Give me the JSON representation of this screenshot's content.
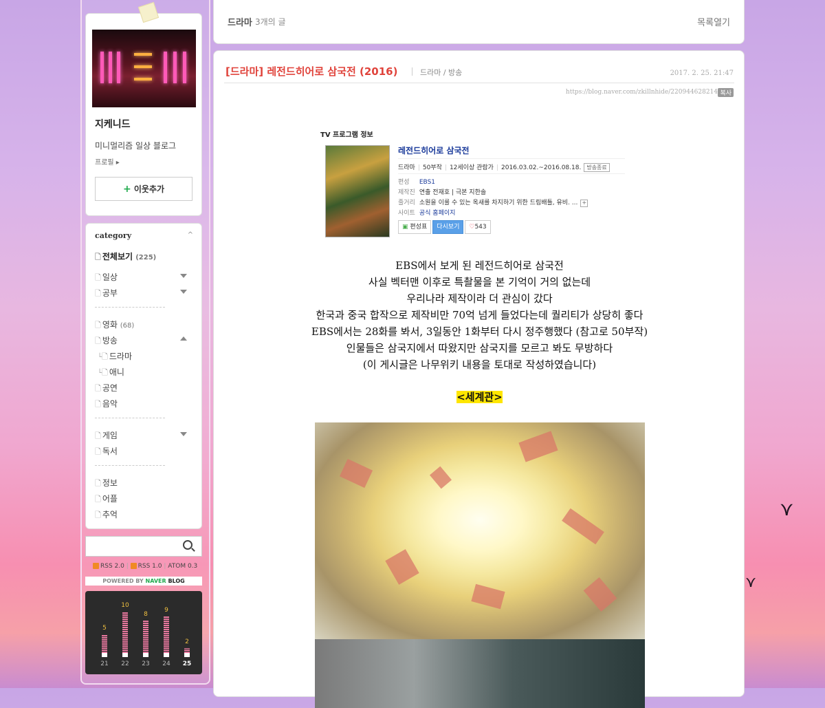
{
  "sidebar": {
    "blog_name": "지케니드",
    "blog_desc": "미니멀리즘 일상 블로그",
    "profile_link": "프로필",
    "add_neighbor": "이웃추가",
    "category": {
      "title": "category",
      "toggle": "^",
      "all": {
        "label": "전체보기",
        "count": "(225)"
      },
      "items": [
        {
          "label": "일상"
        },
        {
          "label": "공부"
        },
        {
          "label": "영화",
          "count": "(68)"
        },
        {
          "label": "방송"
        },
        {
          "label": "드라마"
        },
        {
          "label": "애니"
        },
        {
          "label": "공연"
        },
        {
          "label": "음악"
        },
        {
          "label": "게임"
        },
        {
          "label": "독서"
        },
        {
          "label": "정보"
        },
        {
          "label": "어플"
        },
        {
          "label": "추억"
        }
      ]
    },
    "search_placeholder": "",
    "rss": [
      "RSS 2.0",
      "RSS 1.0",
      "ATOM 0.3"
    ],
    "powered": {
      "prefix": "POWERED BY ",
      "naver": "NAVER",
      "blog": " BLOG"
    },
    "visitor_stats": [
      {
        "day": "21",
        "count": 5
      },
      {
        "day": "22",
        "count": 10
      },
      {
        "day": "23",
        "count": 8
      },
      {
        "day": "24",
        "count": 9
      },
      {
        "day": "25",
        "count": 2
      }
    ],
    "colors": {
      "bar": "#e9789f",
      "value": "#f0c040"
    }
  },
  "topbar": {
    "category": "드라마",
    "count_text": "3개의 글",
    "open_list": "목록열기"
  },
  "post": {
    "title": "[드라마] 레전드히어로 삼국전 (2016)",
    "category": "드라마 / 방송",
    "date": "2017. 2. 25. 21:47",
    "url": "https://blog.naver.com/zkillnhide/220944628214",
    "copy": "복사",
    "tv": {
      "header": "TV 프로그램 정보",
      "name": "레전드히어로 삼국전",
      "meta": [
        "드라마",
        "50부작",
        "12세이상 관람가",
        "2016.03.02.~2016.08.18."
      ],
      "badge": "방송종료",
      "rows": [
        {
          "k": "편성",
          "v": "EBS1"
        },
        {
          "k": "제작진",
          "v": "연출 전재호 | 극본 지한솔"
        },
        {
          "k": "줄거리",
          "v": "소원을 이룰 수 있는 옥새를 차지하기 위한 드림배틀, 유비. ..."
        },
        {
          "k": "사이트",
          "v": "공식 홈페이지"
        }
      ],
      "plus": "+",
      "btn_schedule": "편성표",
      "btn_replay": "다시보기",
      "likes": "543"
    },
    "body_lines": [
      "EBS에서 보게 된 레전드히어로 삼국전",
      "사실 벡터맨 이후로 특촬물을 본 기억이 거의 없는데",
      "우리나라 제작이라 더 관심이 갔다",
      "한국과 중국 합작으로 제작비만 70억 넘게 들었다는데 퀄리티가 상당히 좋다",
      "EBS에서는 28화를 봐서, 3일동안 1화부터 다시 정주행했다 (참고로 50부작)",
      "인물들은 삼국지에서 따왔지만 삼국지를 모르고 봐도 무방하다",
      "(이 게시글은 나무위키 내용을 토대로 작성하였습니다)"
    ],
    "heading": "<세계관>"
  }
}
